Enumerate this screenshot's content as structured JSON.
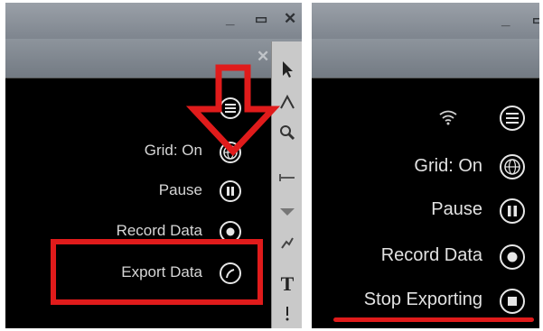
{
  "left_panel": {
    "items": [
      {
        "label": "Grid: On",
        "icon": "globe-icon"
      },
      {
        "label": "Pause",
        "icon": "pause-icon"
      },
      {
        "label": "Record Data",
        "icon": "record-icon"
      },
      {
        "label": "Export Data",
        "icon": "export-icon"
      }
    ],
    "menu_icon": "menu-icon"
  },
  "right_panel": {
    "items": [
      {
        "label": "Grid: On",
        "icon": "globe-icon"
      },
      {
        "label": "Pause",
        "icon": "pause-icon"
      },
      {
        "label": "Record Data",
        "icon": "record-icon"
      },
      {
        "label": "Stop Exporting",
        "icon": "stop-icon"
      }
    ],
    "status_icon": "wifi-icon",
    "menu_icon": "menu-icon"
  },
  "toolbar": {
    "tools": [
      "pointer-icon",
      "draw-icon",
      "zoom-icon",
      "line-icon",
      "shape-icon",
      "brush-icon",
      "text-icon",
      "annotation-icon"
    ],
    "text_tool_glyph": "T"
  },
  "annotation_color": "#e01b1b"
}
